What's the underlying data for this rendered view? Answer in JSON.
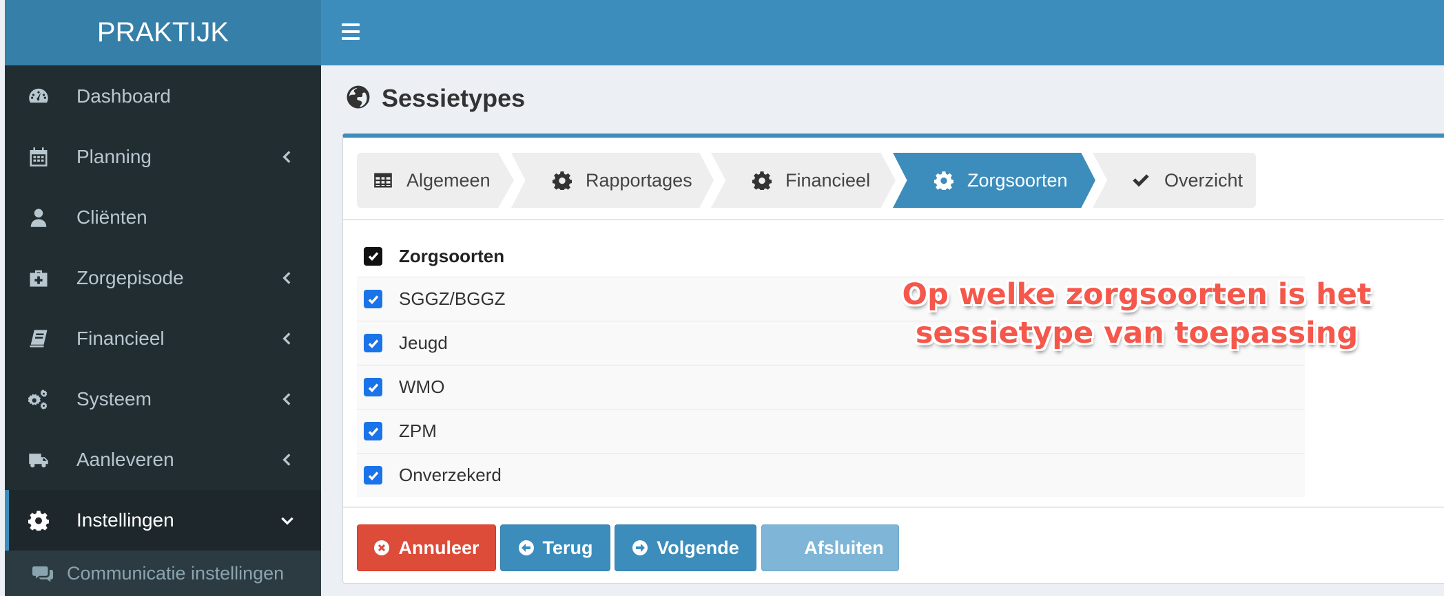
{
  "app": {
    "logo": "PRAKTIJK"
  },
  "sidebar": {
    "items": [
      {
        "label": "Dashboard",
        "icon": "dashboard-icon",
        "submenu": false
      },
      {
        "label": "Planning",
        "icon": "calendar-icon",
        "submenu": true
      },
      {
        "label": "Cliënten",
        "icon": "user-icon",
        "submenu": false
      },
      {
        "label": "Zorgepisode",
        "icon": "medkit-icon",
        "submenu": true
      },
      {
        "label": "Financieel",
        "icon": "book-icon",
        "submenu": true
      },
      {
        "label": "Systeem",
        "icon": "gears-icon",
        "submenu": true
      },
      {
        "label": "Aanleveren",
        "icon": "truck-icon",
        "submenu": true
      },
      {
        "label": "Instellingen",
        "icon": "gear-icon",
        "submenu": true,
        "expanded": true,
        "active": true
      }
    ],
    "subitems": [
      {
        "label": "Communicatie instellingen",
        "icon": "comments-icon"
      }
    ]
  },
  "page": {
    "title": "Sessietypes",
    "icon": "globe-icon"
  },
  "wizard": {
    "steps": [
      {
        "label": "Algemeen",
        "icon": "table-icon",
        "active": false
      },
      {
        "label": "Rapportages",
        "icon": "gear-icon",
        "active": false
      },
      {
        "label": "Financieel",
        "icon": "gear-icon",
        "active": false
      },
      {
        "label": "Zorgsoorten",
        "icon": "gear-icon",
        "active": true
      },
      {
        "label": "Overzicht",
        "icon": "check-icon",
        "active": false
      }
    ]
  },
  "zorgsoorten": {
    "header": "Zorgsoorten",
    "header_checked": true,
    "options": [
      {
        "label": "SGGZ/BGGZ",
        "checked": true
      },
      {
        "label": "Jeugd",
        "checked": true
      },
      {
        "label": "WMO",
        "checked": true
      },
      {
        "label": "ZPM",
        "checked": true
      },
      {
        "label": "Onverzekerd",
        "checked": true
      }
    ]
  },
  "buttons": {
    "cancel": "Annuleer",
    "back": "Terug",
    "next": "Volgende",
    "finish": "Afsluiten"
  },
  "annotation": {
    "line1": "Op welke zorgsoorten is het",
    "line2": "sessietype van toepassing"
  },
  "colors": {
    "primary": "#3c8dbc",
    "header_dark": "#367fa9",
    "sidebar": "#222d32",
    "danger": "#dd4b39",
    "annotation": "#f5574b"
  }
}
